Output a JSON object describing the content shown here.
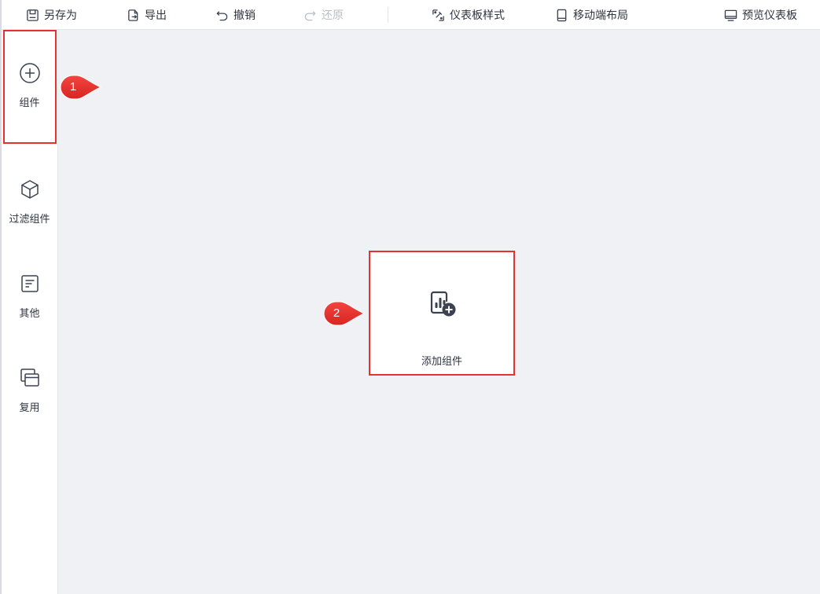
{
  "toolbar": {
    "save_as": "另存为",
    "export": "导出",
    "undo": "撤销",
    "redo": "还原",
    "dashboard_style": "仪表板样式",
    "mobile_layout": "移动端布局",
    "preview": "预览仪表板"
  },
  "sidebar": {
    "items": [
      {
        "label": "组件",
        "icon": "plus-circle-icon"
      },
      {
        "label": "过滤组件",
        "icon": "cube-icon"
      },
      {
        "label": "其他",
        "icon": "document-icon"
      },
      {
        "label": "复用",
        "icon": "windows-icon"
      }
    ]
  },
  "canvas": {
    "add_component_label": "添加组件",
    "add_component_icon": "chart-add-icon"
  },
  "annotations": {
    "step1": "1",
    "step2": "2"
  },
  "colors": {
    "highlight": "#e8302f",
    "canvas_bg": "#f0f1f5",
    "icon": "#3b4250",
    "disabled": "#b9bec7"
  }
}
